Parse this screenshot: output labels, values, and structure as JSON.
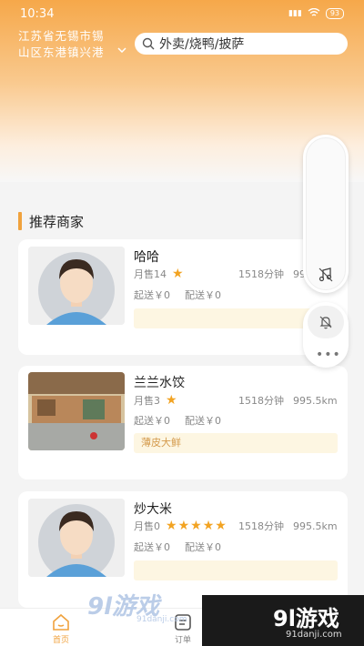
{
  "status": {
    "time": "10:34",
    "signal": "5G",
    "battery": "93"
  },
  "header": {
    "location_line1": "江苏省无锡市锡",
    "location_line2": "山区东港镇兴港",
    "search_placeholder": "外卖/烧鸭/披萨"
  },
  "section": {
    "title": "推荐商家"
  },
  "shops": [
    {
      "name": "哈哈",
      "sales": "月售14",
      "stars": 1,
      "time": "1518分钟",
      "distance": "995",
      "min_order": "起送￥0",
      "delivery": "配送￥0",
      "tag": ""
    },
    {
      "name": "兰兰水饺",
      "sales": "月售3",
      "stars": 1,
      "time": "1518分钟",
      "distance": "995.5km",
      "min_order": "起送￥0",
      "delivery": "配送￥0",
      "tag": "薄皮大鲜"
    },
    {
      "name": "炒大米",
      "sales": "月售0",
      "stars": 5,
      "time": "1518分钟",
      "distance": "995.5km",
      "min_order": "起送￥0",
      "delivery": "配送￥0",
      "tag": ""
    }
  ],
  "tabbar": {
    "home": "首页",
    "orders": "订单"
  },
  "watermark": {
    "left_logo": "9l游戏",
    "left_url": "91danji.com",
    "right_logo": "9l游戏",
    "right_url": "91danji.com"
  },
  "colors": {
    "accent": "#f0a23d",
    "star": "#f2a322",
    "tag_bg": "#fdf6e2"
  }
}
